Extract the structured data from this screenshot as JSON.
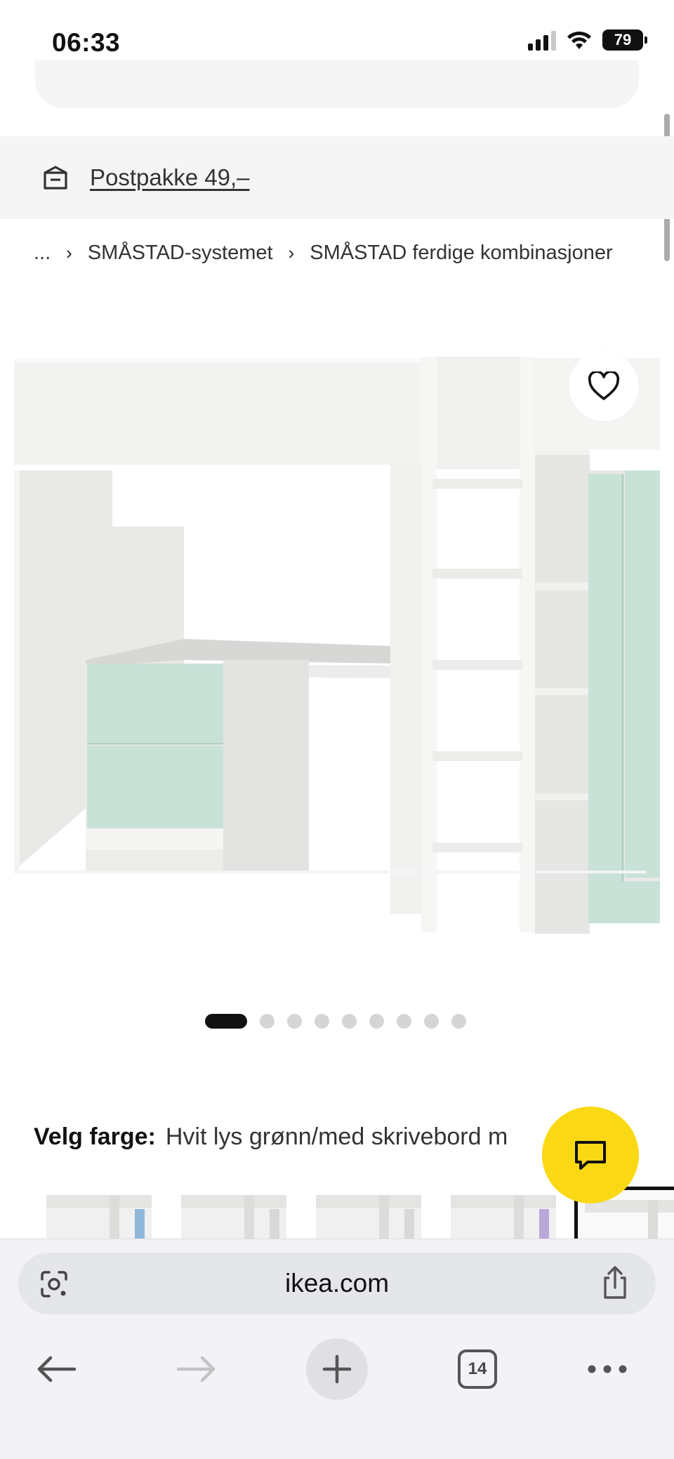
{
  "status_bar": {
    "time": "06:33",
    "battery": "79"
  },
  "shipping": {
    "label": "Postpakke 49,–"
  },
  "breadcrumb": {
    "items": [
      "...",
      "SMÅSTAD-systemet",
      "SMÅSTAD ferdige kombinasjoner"
    ]
  },
  "gallery": {
    "image_count": 9,
    "active_index": 0
  },
  "color_selection": {
    "label": "Velg farge:",
    "value": "Hvit lys grønn/med skrivebord m"
  },
  "thumbnails": [
    {
      "accent": "#8fb8d8"
    },
    {
      "accent": "#d8d8d8"
    },
    {
      "accent": "#d8d8d8"
    },
    {
      "accent": "#b9a9d9"
    },
    {
      "accent": "#c8e2d8"
    }
  ],
  "browser": {
    "url": "ikea.com",
    "tab_count": "14"
  },
  "colors": {
    "chat_yellow": "#fad914",
    "mint_green": "#c8e2d8",
    "banner_grey": "#f5f5f5"
  }
}
